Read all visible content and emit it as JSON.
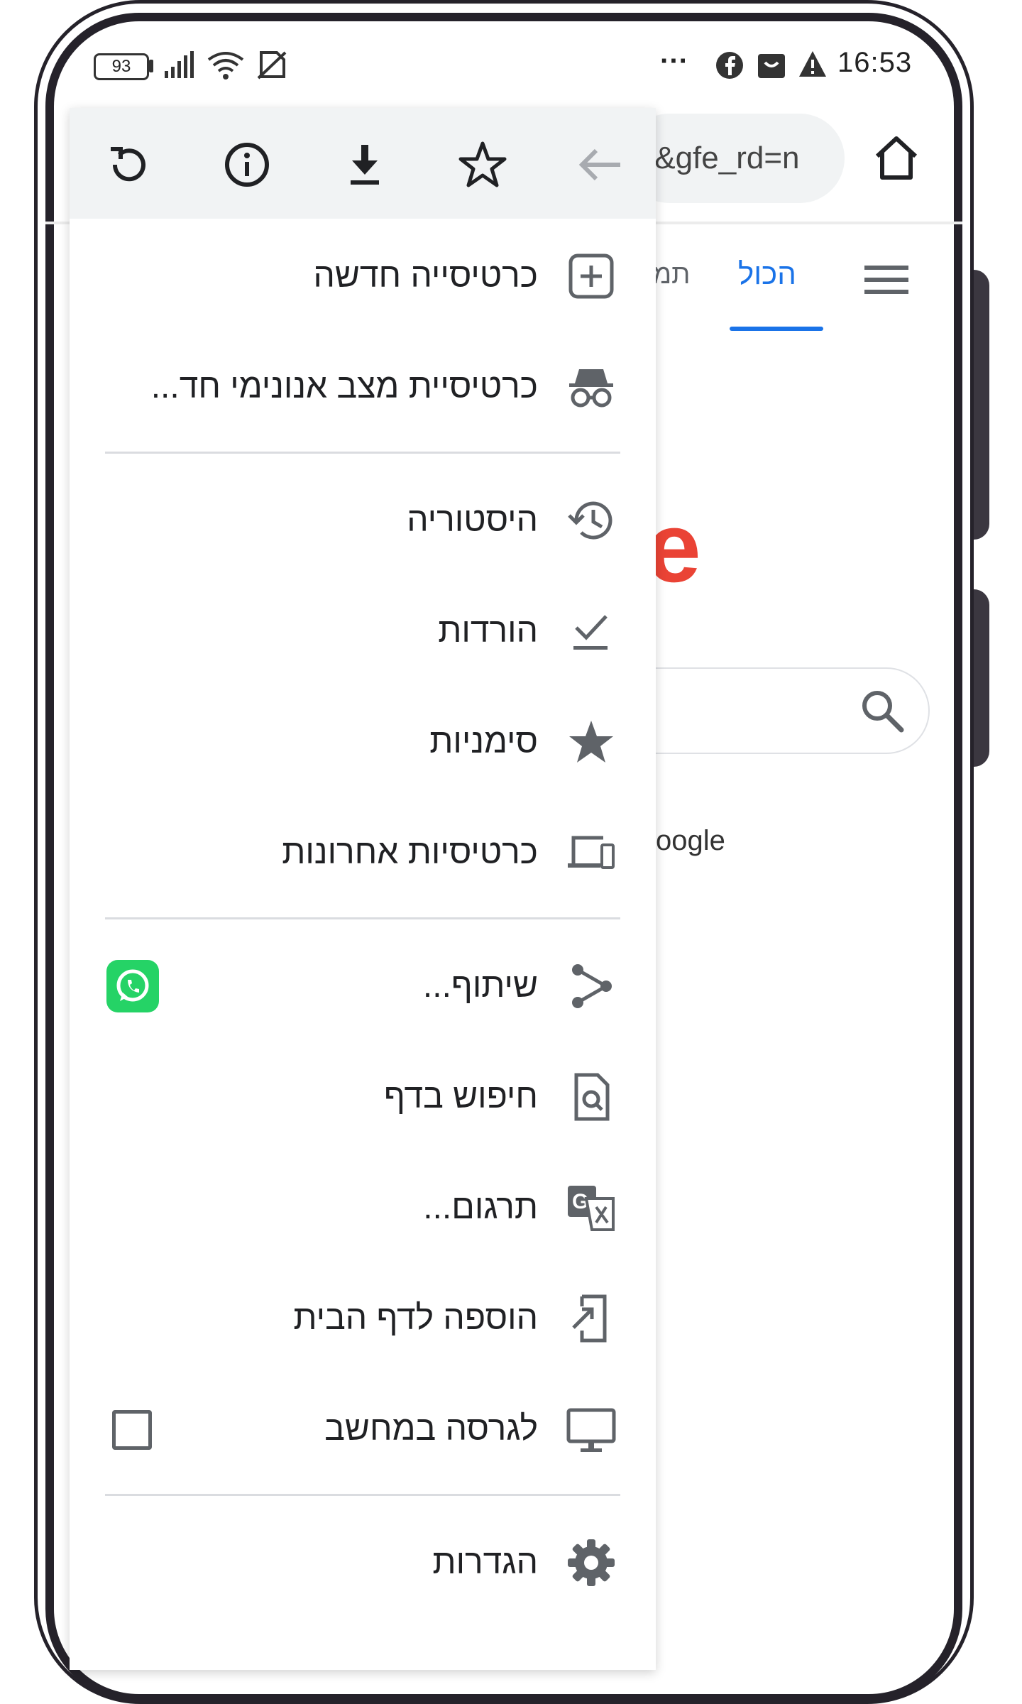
{
  "status_bar": {
    "battery": "93",
    "time": "16:53",
    "more": "···"
  },
  "browser": {
    "url_fragment": "/&gfe_rd=n",
    "tabs": [
      {
        "label": "הכול",
        "active": true
      },
      {
        "label": "תמ",
        "active": false
      }
    ],
    "logo_fragment": "e",
    "footer_fragment": "oogle"
  },
  "menu": {
    "top_icons": [
      "refresh-icon",
      "info-icon",
      "download-icon",
      "star-outline-icon",
      "back-arrow-icon"
    ],
    "items": [
      {
        "label": "כרטיסייה חדשה",
        "icon": "new-tab-icon"
      },
      {
        "label": "כרטיסיית מצב אנונימי חד...",
        "icon": "incognito-icon"
      },
      {
        "label": "היסטוריה",
        "icon": "history-icon"
      },
      {
        "label": "הורדות",
        "icon": "downloads-check-icon"
      },
      {
        "label": "סימניות",
        "icon": "bookmark-star-icon"
      },
      {
        "label": "כרטיסיות אחרונות",
        "icon": "recent-tabs-icon"
      },
      {
        "label": "שיתוף...",
        "icon": "share-icon"
      },
      {
        "label": "חיפוש בדף",
        "icon": "find-in-page-icon"
      },
      {
        "label": "תרגום...",
        "icon": "translate-icon"
      },
      {
        "label": "הוספה לדף הבית",
        "icon": "add-to-home-icon"
      },
      {
        "label": "לגרסה במחשב",
        "icon": "desktop-icon"
      },
      {
        "label": "הגדרות",
        "icon": "settings-icon"
      }
    ],
    "desktop_checkbox_checked": false
  },
  "colors": {
    "accent": "#1a73e8",
    "menu_header_bg": "#f1f3f4",
    "whatsapp": "#25d366",
    "frame": "#25222a"
  }
}
